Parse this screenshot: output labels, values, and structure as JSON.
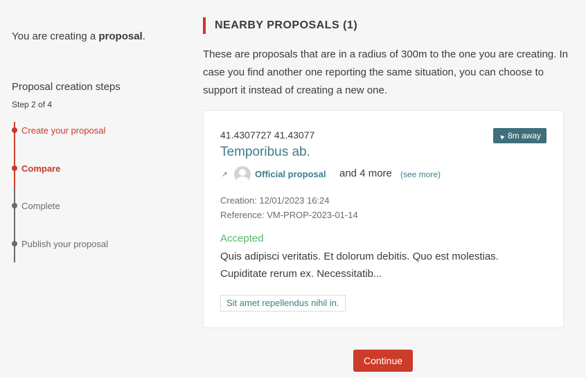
{
  "sidebar": {
    "creating_prefix": "You are creating a",
    "creating_bold": "proposal",
    "creating_suffix": ".",
    "steps_title": "Proposal creation steps",
    "steps_count": "Step 2 of 4",
    "steps": [
      {
        "label": "Create your proposal",
        "state": "done"
      },
      {
        "label": "Compare",
        "state": "current"
      },
      {
        "label": "Complete",
        "state": "todo"
      },
      {
        "label": "Publish your proposal",
        "state": "todo"
      }
    ]
  },
  "main": {
    "heading": "Nearby proposals (1)",
    "intro": "These are proposals that are in a radius of 300m to the one you are creating. In case you find another one reporting the same situation, you can choose to support it instead of creating a new one.",
    "card": {
      "coordinates": "41.4307727 41.43077",
      "distance": "8m away",
      "title": "Temporibus ab.",
      "author": "Official proposal",
      "more_authors": "and 4 more",
      "see_more": "(see more)",
      "creation": "Creation: 12/01/2023 16:24",
      "reference": "Reference: VM-PROP-2023-01-14",
      "status": "Accepted",
      "body": "Quis adipisci veritatis. Et dolorum debitis. Quo est molestias. Cupiditate rerum ex. Necessitatib...",
      "tag": "Sit amet repellendus nihil in."
    },
    "continue_label": "Continue"
  },
  "icons": {
    "distance": "location-arrow-icon",
    "external": "external-link-icon",
    "avatar": "default-avatar-icon"
  },
  "colors": {
    "accent_red": "#c9392b",
    "link_teal": "#3e7d88",
    "badge_teal": "#3e6f7a",
    "status_green": "#57b66e"
  }
}
